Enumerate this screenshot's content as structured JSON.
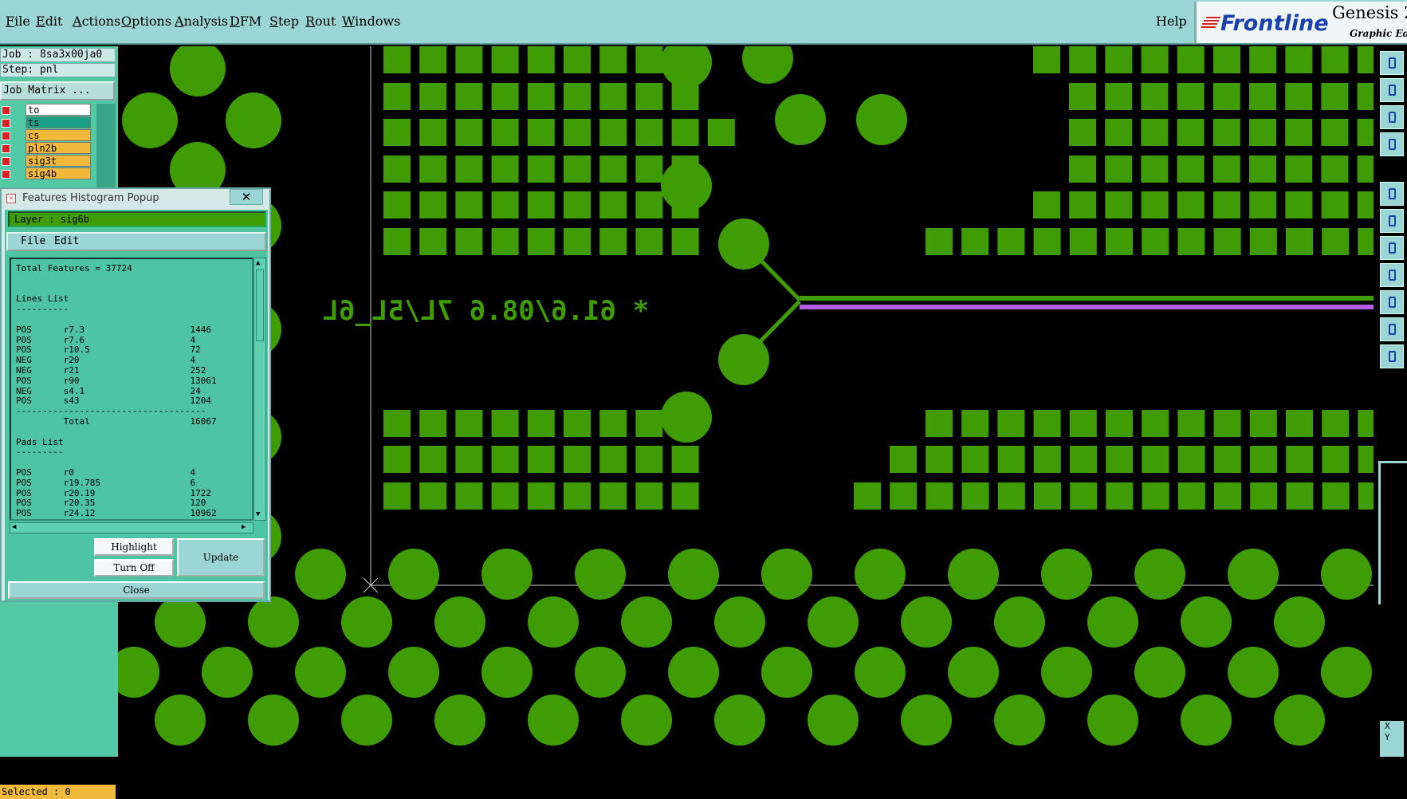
{
  "menubar": {
    "items": [
      {
        "label": "File",
        "u": "F",
        "rest": "ile"
      },
      {
        "label": "Edit",
        "u": "E",
        "rest": "dit"
      },
      {
        "label": "Actions",
        "u": "A",
        "rest": "ctions"
      },
      {
        "label": "Options",
        "u": "O",
        "rest": "ptions"
      },
      {
        "label": "Analysis",
        "u": "A",
        "rest": "nalysis"
      },
      {
        "label": "DFM",
        "u": "D",
        "rest": "FM"
      },
      {
        "label": "Step",
        "u": "S",
        "rest": "tep"
      },
      {
        "label": "Rout",
        "u": "R",
        "rest": "out"
      },
      {
        "label": "Windows",
        "u": "W",
        "rest": "indows"
      }
    ],
    "help": "Help"
  },
  "brand": {
    "logo": "Frontline",
    "product": "Genesis 2",
    "subtitle": "Graphic Edi"
  },
  "left_panel": {
    "job": "Job : 8sa3x00ja0",
    "step": "Step: pnl",
    "job_matrix": "Job Matrix ...",
    "layers": [
      {
        "name": "to",
        "color": "#ffffff"
      },
      {
        "name": "ts",
        "color": "#1aa089"
      },
      {
        "name": "cs",
        "color": "#f1b93b"
      },
      {
        "name": "pln2b",
        "color": "#f1b93b"
      },
      {
        "name": "sig3t",
        "color": "#f1b93b"
      },
      {
        "name": "sig4b",
        "color": "#f1b93b"
      }
    ],
    "selected": "Selected : 0"
  },
  "popup": {
    "title": "Features Histogram Popup",
    "close_glyph": "✕",
    "layer": "Layer :  sig6b",
    "menu": [
      "File",
      "Edit"
    ],
    "list_text": "Total Features = 37724\n\n\nLines List\n----------\n\nPOS      r7.3                    1446\nPOS      r7.6                    4\nPOS      r10.5                   72\nNEG      r20                     4\nNEG      r21                     252\nPOS      r90                     13061\nNEG      s4.1                    24\nPOS      s43                     1204\n------------------------------------\n         Total                   16067\n\nPads List\n---------\n\nPOS      r0                      4\nPOS      r19.785                 6\nPOS      r20.19                  1722\nPOS      r20.35                  120\nPOS      r24.12                  10962",
    "buttons": {
      "highlight": "Highlight",
      "turn_off": "Turn Off",
      "update": "Update",
      "close": "Close"
    }
  },
  "canvas": {
    "mirrored_text": "* 61.6/08.6 7L/5L_6L",
    "colors": {
      "copper": "#3f9c04",
      "trace_purple": "#b35fe6",
      "background": "#000000",
      "outline": "#cccccc"
    }
  },
  "right_bar": {
    "xy_label": "X\nY"
  }
}
